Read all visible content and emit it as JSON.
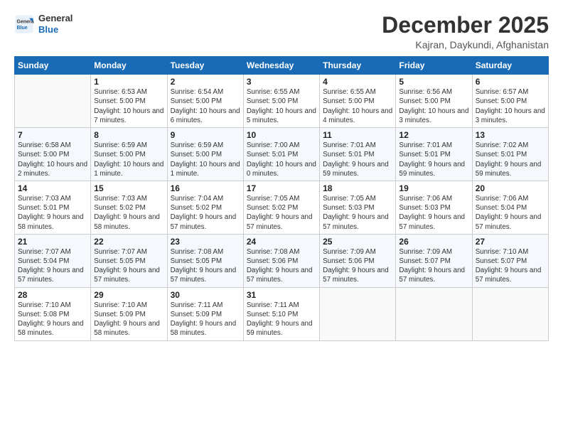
{
  "header": {
    "logo_line1": "General",
    "logo_line2": "Blue",
    "month": "December 2025",
    "location": "Kajran, Daykundi, Afghanistan"
  },
  "weekdays": [
    "Sunday",
    "Monday",
    "Tuesday",
    "Wednesday",
    "Thursday",
    "Friday",
    "Saturday"
  ],
  "weeks": [
    [
      {
        "day": "",
        "sunrise": "",
        "sunset": "",
        "daylight": ""
      },
      {
        "day": "1",
        "sunrise": "6:53 AM",
        "sunset": "5:00 PM",
        "daylight": "10 hours and 7 minutes."
      },
      {
        "day": "2",
        "sunrise": "6:54 AM",
        "sunset": "5:00 PM",
        "daylight": "10 hours and 6 minutes."
      },
      {
        "day": "3",
        "sunrise": "6:55 AM",
        "sunset": "5:00 PM",
        "daylight": "10 hours and 5 minutes."
      },
      {
        "day": "4",
        "sunrise": "6:55 AM",
        "sunset": "5:00 PM",
        "daylight": "10 hours and 4 minutes."
      },
      {
        "day": "5",
        "sunrise": "6:56 AM",
        "sunset": "5:00 PM",
        "daylight": "10 hours and 3 minutes."
      },
      {
        "day": "6",
        "sunrise": "6:57 AM",
        "sunset": "5:00 PM",
        "daylight": "10 hours and 3 minutes."
      }
    ],
    [
      {
        "day": "7",
        "sunrise": "6:58 AM",
        "sunset": "5:00 PM",
        "daylight": "10 hours and 2 minutes."
      },
      {
        "day": "8",
        "sunrise": "6:59 AM",
        "sunset": "5:00 PM",
        "daylight": "10 hours and 1 minute."
      },
      {
        "day": "9",
        "sunrise": "6:59 AM",
        "sunset": "5:00 PM",
        "daylight": "10 hours and 1 minute."
      },
      {
        "day": "10",
        "sunrise": "7:00 AM",
        "sunset": "5:01 PM",
        "daylight": "10 hours and 0 minutes."
      },
      {
        "day": "11",
        "sunrise": "7:01 AM",
        "sunset": "5:01 PM",
        "daylight": "9 hours and 59 minutes."
      },
      {
        "day": "12",
        "sunrise": "7:01 AM",
        "sunset": "5:01 PM",
        "daylight": "9 hours and 59 minutes."
      },
      {
        "day": "13",
        "sunrise": "7:02 AM",
        "sunset": "5:01 PM",
        "daylight": "9 hours and 59 minutes."
      }
    ],
    [
      {
        "day": "14",
        "sunrise": "7:03 AM",
        "sunset": "5:01 PM",
        "daylight": "9 hours and 58 minutes."
      },
      {
        "day": "15",
        "sunrise": "7:03 AM",
        "sunset": "5:02 PM",
        "daylight": "9 hours and 58 minutes."
      },
      {
        "day": "16",
        "sunrise": "7:04 AM",
        "sunset": "5:02 PM",
        "daylight": "9 hours and 57 minutes."
      },
      {
        "day": "17",
        "sunrise": "7:05 AM",
        "sunset": "5:02 PM",
        "daylight": "9 hours and 57 minutes."
      },
      {
        "day": "18",
        "sunrise": "7:05 AM",
        "sunset": "5:03 PM",
        "daylight": "9 hours and 57 minutes."
      },
      {
        "day": "19",
        "sunrise": "7:06 AM",
        "sunset": "5:03 PM",
        "daylight": "9 hours and 57 minutes."
      },
      {
        "day": "20",
        "sunrise": "7:06 AM",
        "sunset": "5:04 PM",
        "daylight": "9 hours and 57 minutes."
      }
    ],
    [
      {
        "day": "21",
        "sunrise": "7:07 AM",
        "sunset": "5:04 PM",
        "daylight": "9 hours and 57 minutes."
      },
      {
        "day": "22",
        "sunrise": "7:07 AM",
        "sunset": "5:05 PM",
        "daylight": "9 hours and 57 minutes."
      },
      {
        "day": "23",
        "sunrise": "7:08 AM",
        "sunset": "5:05 PM",
        "daylight": "9 hours and 57 minutes."
      },
      {
        "day": "24",
        "sunrise": "7:08 AM",
        "sunset": "5:06 PM",
        "daylight": "9 hours and 57 minutes."
      },
      {
        "day": "25",
        "sunrise": "7:09 AM",
        "sunset": "5:06 PM",
        "daylight": "9 hours and 57 minutes."
      },
      {
        "day": "26",
        "sunrise": "7:09 AM",
        "sunset": "5:07 PM",
        "daylight": "9 hours and 57 minutes."
      },
      {
        "day": "27",
        "sunrise": "7:10 AM",
        "sunset": "5:07 PM",
        "daylight": "9 hours and 57 minutes."
      }
    ],
    [
      {
        "day": "28",
        "sunrise": "7:10 AM",
        "sunset": "5:08 PM",
        "daylight": "9 hours and 58 minutes."
      },
      {
        "day": "29",
        "sunrise": "7:10 AM",
        "sunset": "5:09 PM",
        "daylight": "9 hours and 58 minutes."
      },
      {
        "day": "30",
        "sunrise": "7:11 AM",
        "sunset": "5:09 PM",
        "daylight": "9 hours and 58 minutes."
      },
      {
        "day": "31",
        "sunrise": "7:11 AM",
        "sunset": "5:10 PM",
        "daylight": "9 hours and 59 minutes."
      },
      {
        "day": "",
        "sunrise": "",
        "sunset": "",
        "daylight": ""
      },
      {
        "day": "",
        "sunrise": "",
        "sunset": "",
        "daylight": ""
      },
      {
        "day": "",
        "sunrise": "",
        "sunset": "",
        "daylight": ""
      }
    ]
  ],
  "labels": {
    "sunrise": "Sunrise:",
    "sunset": "Sunset:",
    "daylight": "Daylight:"
  }
}
